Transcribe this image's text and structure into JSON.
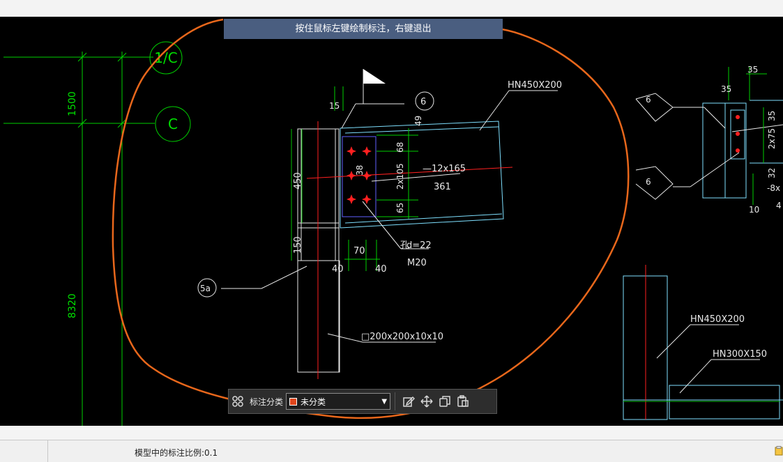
{
  "hint": {
    "text": "按住鼠标左键绘制标注，右键退出"
  },
  "toolbar": {
    "category_label": "标注分类",
    "category_value": "未分类",
    "category_color": "#e0461c",
    "icons": [
      "grid-icon",
      "edit-icon",
      "move-icon",
      "copy-icon",
      "paste-icon"
    ]
  },
  "status": {
    "scale_text": "模型中的标注比例:0.1"
  },
  "drawing": {
    "grid_labels": [
      "1/C",
      "C"
    ],
    "dimensions": [
      "1500",
      "8320"
    ],
    "annotations": {
      "beam_main": "HN450X200",
      "plate": "—12x165",
      "plate_length": "361",
      "bolt_hole": "d=22",
      "bolt_hole_prefix": "孔",
      "bolt": "M20",
      "column": "□200x200x10x10",
      "detail_6": "6",
      "detail_5a": "5a",
      "beam_right_1": "HN450X200",
      "beam_right_2": "HN300X150"
    },
    "dims_left": [
      "450",
      "150"
    ],
    "dims_plate": [
      "49",
      "68",
      "2x105",
      "65",
      "38"
    ],
    "dims_bottom": [
      "70",
      "40",
      "40"
    ],
    "weld": "15",
    "right_detail": {
      "weld_symbols": [
        "6",
        "6"
      ],
      "dims": [
        "35",
        "35",
        "35",
        "2x75",
        "32",
        "-8x",
        "4",
        "10"
      ]
    }
  },
  "colors": {
    "accent_orange": "#e8671b",
    "cad_green": "#00ff00",
    "cad_cyan": "#7fe0ff",
    "cad_red": "#ff2020"
  }
}
